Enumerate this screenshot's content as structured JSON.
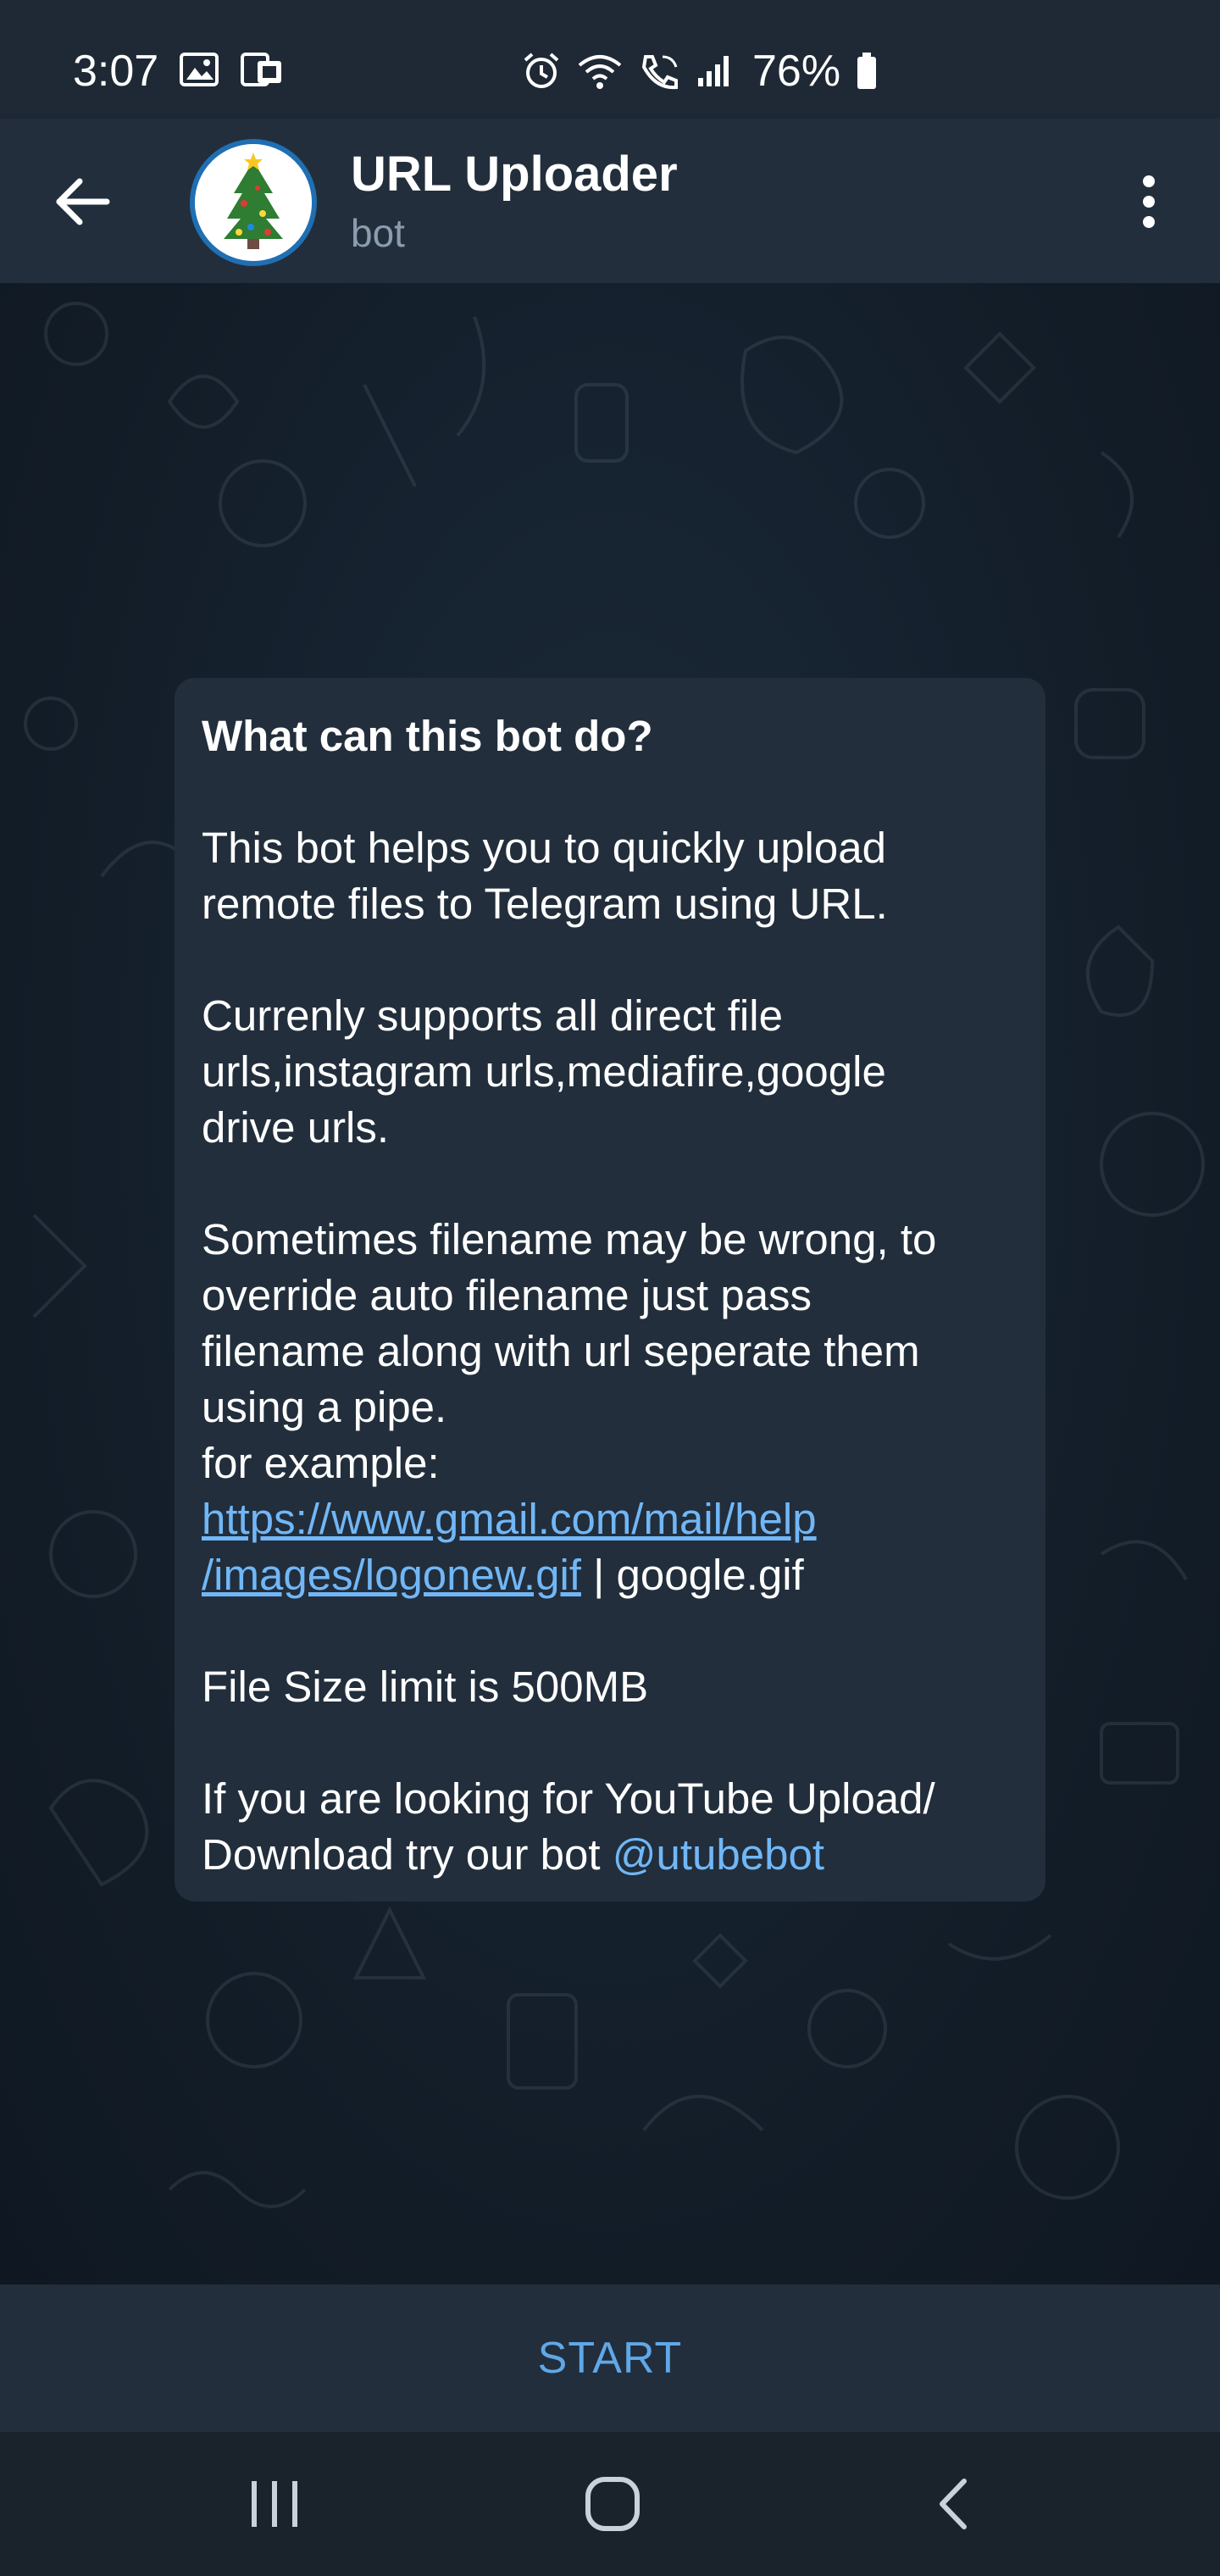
{
  "status_bar": {
    "time": "3:07",
    "battery": "76%",
    "left_icons": [
      "image-icon",
      "device-sync-icon"
    ],
    "right_icons": [
      "alarm-icon",
      "wifi-call-icon",
      "phone-wifi-icon",
      "signal-icon",
      "battery-icon"
    ]
  },
  "header": {
    "title": "URL Uploader",
    "subtitle": "bot",
    "back_icon": "back-arrow-icon",
    "menu_icon": "more-vertical-icon"
  },
  "card": {
    "title": "What can this bot do?",
    "p1": "This bot helps you to quickly upload\nremote files to Telegram using URL.",
    "p2": "Currenly supports all direct file\nurls,instagram urls,mediafire,google\ndrive urls.",
    "p3": "Sometimes filename may be wrong, to\noverride auto filename just pass\nfilename along with url seperate them\nusing a pipe.\nfor example:",
    "example_link_line1": "https://www.gmail.com/mail/help",
    "example_link_line2": "/images/logonew.gif",
    "example_suffix": " | google.gif",
    "p4": "File Size limit is 500MB",
    "p5_line1": "If you are looking for YouTube Upload/",
    "p5_line2_prefix": "Download try our bot ",
    "p5_mention": "@utubebot"
  },
  "start_button": {
    "label": "START"
  },
  "nav_bar": {
    "icons": [
      "recents-icon",
      "home-icon",
      "back-icon"
    ]
  },
  "colors": {
    "link": "#71b7f7",
    "start": "#5fa8e8",
    "header_bg": "#232e3c",
    "card_bg": "#222e3b"
  }
}
